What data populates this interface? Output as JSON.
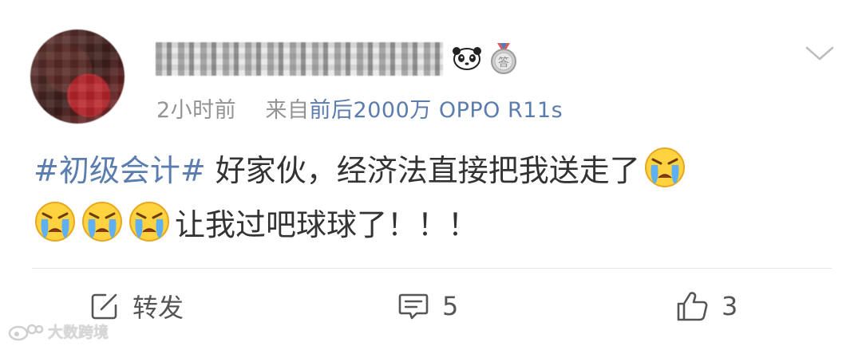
{
  "post": {
    "meta": {
      "time": "2小时前",
      "from_label": "来自",
      "source": "前后2000万 OPPO R11s"
    },
    "content": {
      "topic": "#初级会计#",
      "line1_text": " 好家伙，经济法直接把我送走了",
      "line2_text": "让我过吧球球了！！！",
      "emoji_icon": "crying-face-icon"
    }
  },
  "actions": {
    "repost_label": "转发",
    "comment_count": "5",
    "like_count": "3"
  },
  "watermark": {
    "text": "大数跨境"
  },
  "colors": {
    "link": "#5b7caf",
    "text": "#333333",
    "meta": "#939393"
  }
}
